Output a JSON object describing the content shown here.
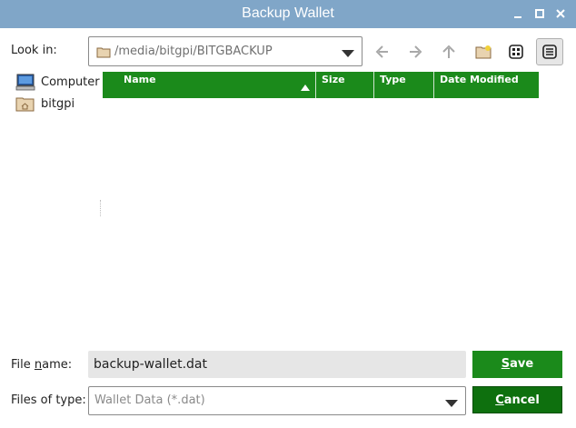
{
  "window": {
    "title": "Backup Wallet"
  },
  "look_in": {
    "label": "Look in:",
    "path": "/media/bitgpi/BITGBACKUP"
  },
  "sidebar": {
    "items": [
      {
        "label": "Computer"
      },
      {
        "label": "bitgpi"
      }
    ]
  },
  "columns": [
    {
      "label": "Name"
    },
    {
      "label": "Size"
    },
    {
      "label": "Type"
    },
    {
      "label": "Date Modified"
    }
  ],
  "file_name": {
    "label_pre": "File ",
    "label_mnemonic": "n",
    "label_post": "ame:",
    "value": "backup-wallet.dat"
  },
  "files_of_type": {
    "label": "Files of type:",
    "value": "Wallet Data (*.dat)"
  },
  "buttons": {
    "save": {
      "mnemonic": "S",
      "rest": "ave"
    },
    "cancel": {
      "mnemonic": "C",
      "rest": "ancel"
    }
  },
  "colors": {
    "titlebar": "#80a6c8",
    "accent": "#1b8a1b",
    "cancel": "#0e700e"
  }
}
